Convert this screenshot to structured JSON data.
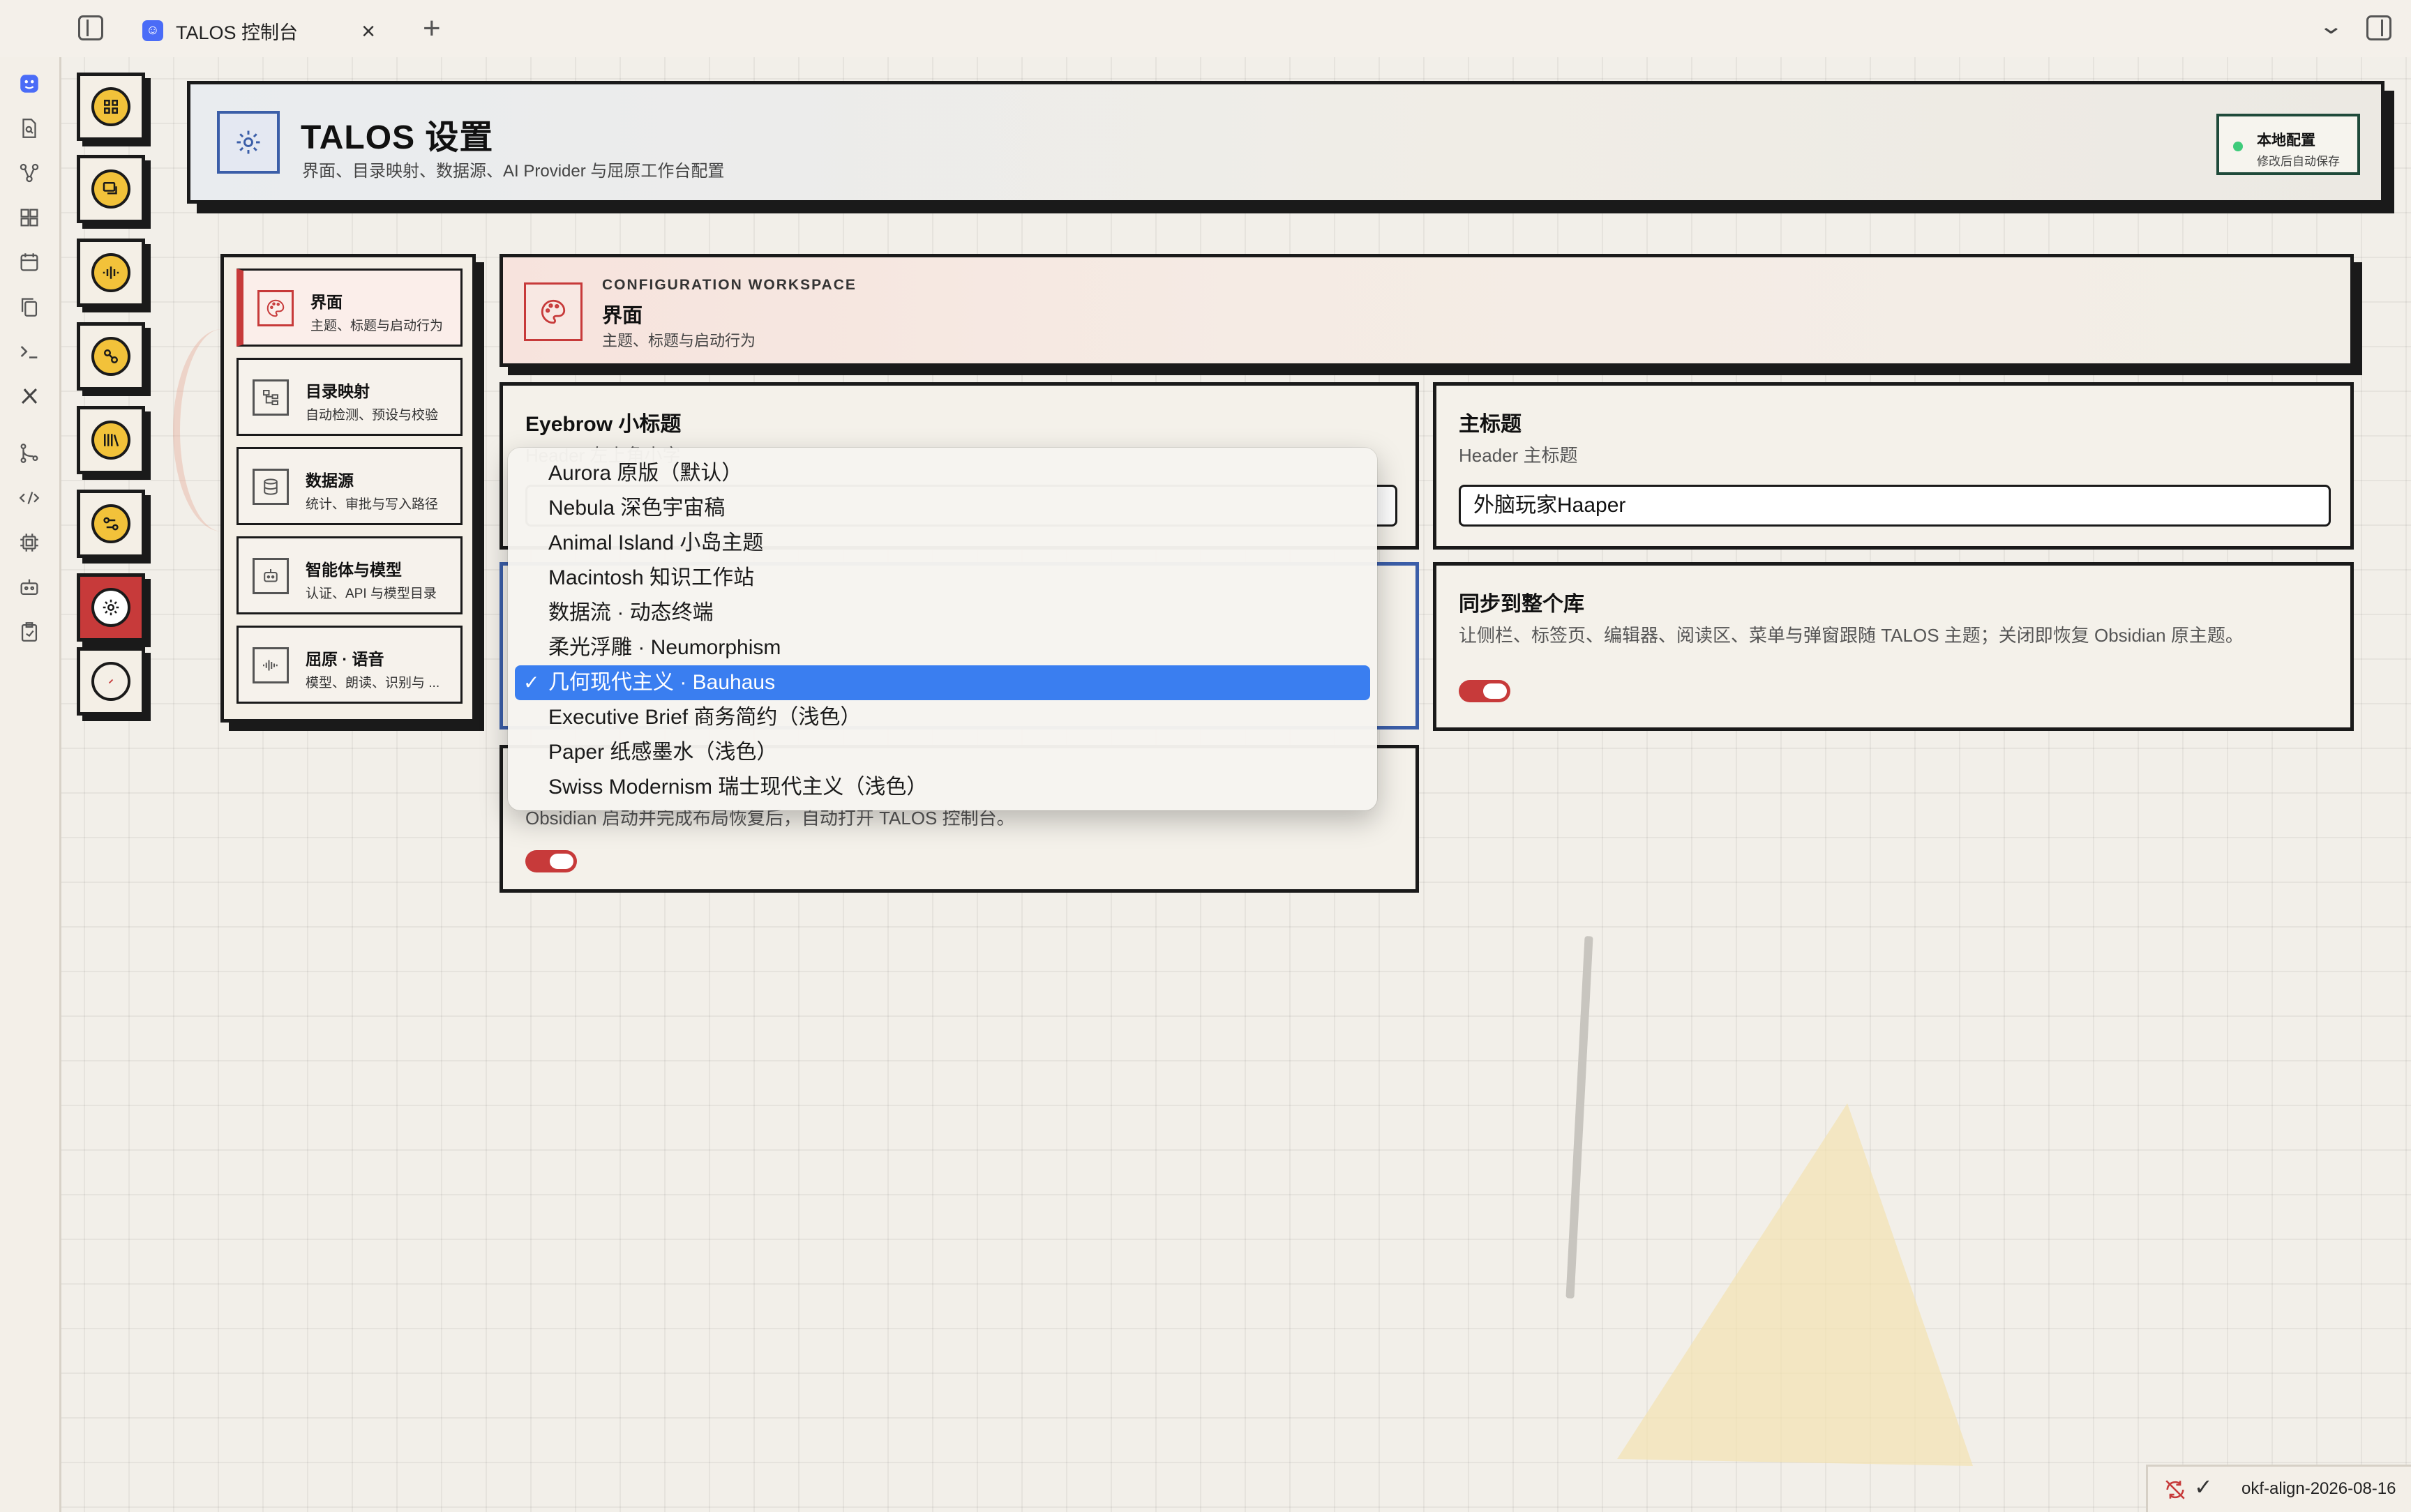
{
  "tab": {
    "title": "TALOS 控制台",
    "icon": "talos-app-icon"
  },
  "ribbon": {
    "icons": [
      "talos-icon",
      "file-search-icon",
      "graph-icon",
      "dashboard-icon",
      "calendar-icon",
      "copy-icon",
      "terminal-icon",
      "tools-icon",
      "git-icon",
      "code-icon",
      "chip-icon",
      "robot-icon",
      "clipboard-icon"
    ]
  },
  "dock": {
    "buttons": [
      "dashboard",
      "chat",
      "voice",
      "workflow",
      "library",
      "transfer",
      "settings",
      "empty"
    ]
  },
  "header": {
    "title": "TALOS 设置",
    "subtitle": "界面、目录映射、数据源、AI Provider 与屈原工作台配置",
    "badge_title": "本地配置",
    "badge_sub": "修改后自动保存"
  },
  "menu": {
    "items": [
      {
        "title": "界面",
        "sub": "主题、标题与启动行为"
      },
      {
        "title": "目录映射",
        "sub": "自动检测、预设与校验"
      },
      {
        "title": "数据源",
        "sub": "统计、审批与写入路径"
      },
      {
        "title": "智能体与模型",
        "sub": "认证、API 与模型目录"
      },
      {
        "title": "屈原 · 语音",
        "sub": "模型、朗读、识别与 ..."
      }
    ]
  },
  "workspace": {
    "eyebrow": "CONFIGURATION WORKSPACE",
    "title": "界面",
    "subtitle": "主题、标题与启动行为"
  },
  "cards": {
    "eyebrow": {
      "title": "Eyebrow 小标题",
      "sub": "Header 左上角小字"
    },
    "main_title": {
      "title": "主标题",
      "sub": "Header 主标题",
      "value": "外脑玩家Haaper"
    },
    "sync": {
      "title": "同步到整个库",
      "sub": "让侧栏、标签页、编辑器、阅读区、菜单与弹窗跟随 TALOS 主题；关闭即恢复 Obsidian 原主题。"
    },
    "autostart": {
      "sub": "Obsidian 启动并完成布局恢复后，自动打开 TALOS 控制台。"
    }
  },
  "theme_dropdown": {
    "options": [
      "Aurora 原版（默认）",
      "Nebula 深色宇宙稿",
      "Animal Island 小岛主题",
      "Macintosh 知识工作站",
      "数据流 · 动态终端",
      "柔光浮雕 · Neumorphism",
      "几何现代主义 · Bauhaus",
      "Executive Brief 商务简约（浅色）",
      "Paper 纸感墨水（浅色）",
      "Swiss Modernism 瑞士现代主义（浅色）"
    ],
    "selected": "几何现代主义 · Bauhaus",
    "check": "✓"
  },
  "statusbar": {
    "text": "okf-align-2026-08-16",
    "check": "✓"
  },
  "colors": {
    "accent_red": "#c73a3a",
    "accent_yellow": "#f2c23a",
    "select_blue": "#3a7ef0",
    "badge_green": "#3ecb7a"
  }
}
